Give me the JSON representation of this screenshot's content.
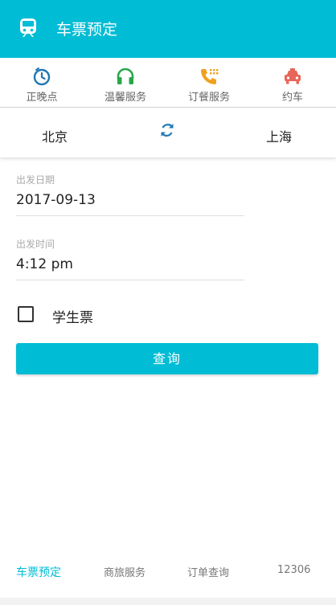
{
  "appbar": {
    "title": "车票预定",
    "icon": "train-icon"
  },
  "quick_actions": [
    {
      "label": "正晚点",
      "icon": "timer-icon",
      "color": "#1f78b4"
    },
    {
      "label": "温馨服务",
      "icon": "headset-icon",
      "color": "#27a74a"
    },
    {
      "label": "订餐服务",
      "icon": "phone-icon",
      "color": "#f0a020"
    },
    {
      "label": "约车",
      "icon": "taxi-icon",
      "color": "#e8655a"
    }
  ],
  "route": {
    "from": "北京",
    "to": "上海",
    "swap_icon": "swap-icon"
  },
  "date_field": {
    "label": "出发日期",
    "value": "2017-09-13"
  },
  "time_field": {
    "label": "出发时间",
    "value": "4:12 pm"
  },
  "student": {
    "label": "学生票",
    "checked": false
  },
  "query_button": {
    "label": "查询"
  },
  "bottom_nav": [
    {
      "label": "车票预定",
      "active": true
    },
    {
      "label": "商旅服务",
      "active": false
    },
    {
      "label": "订单查询",
      "active": false
    },
    {
      "label": "12306",
      "active": false
    }
  ],
  "colors": {
    "accent": "#00bcd4"
  }
}
